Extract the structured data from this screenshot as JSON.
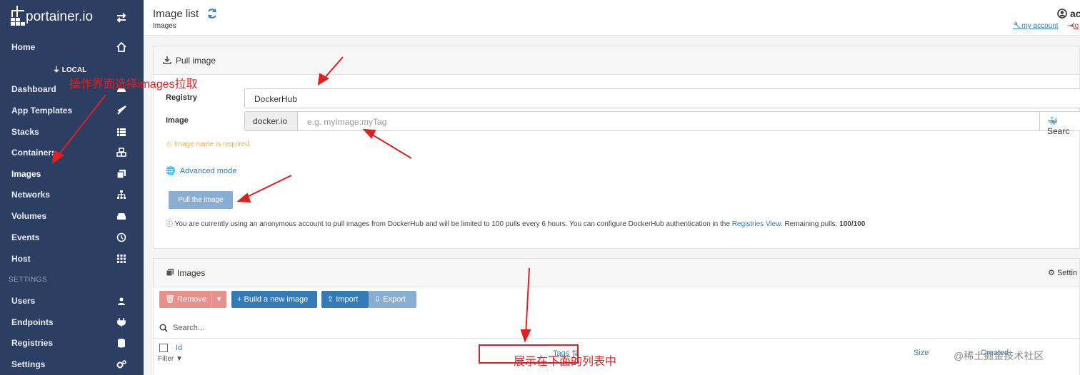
{
  "brand": {
    "name": "portainer.io"
  },
  "sidebar": {
    "home": "Home",
    "endpoint_label": "LOCAL",
    "items": [
      {
        "label": "Dashboard",
        "icon": "tachometer-icon"
      },
      {
        "label": "App Templates",
        "icon": "rocket-icon"
      },
      {
        "label": "Stacks",
        "icon": "th-list-icon"
      },
      {
        "label": "Containers",
        "icon": "cubes-icon"
      },
      {
        "label": "Images",
        "icon": "clone-icon"
      },
      {
        "label": "Networks",
        "icon": "sitemap-icon"
      },
      {
        "label": "Volumes",
        "icon": "hdd-icon"
      },
      {
        "label": "Events",
        "icon": "history-icon"
      },
      {
        "label": "Host",
        "icon": "th-icon"
      }
    ],
    "settings_heading": "SETTINGS",
    "settings_items": [
      {
        "label": "Users",
        "icon": "users-icon"
      },
      {
        "label": "Endpoints",
        "icon": "plug-icon"
      },
      {
        "label": "Registries",
        "icon": "database-icon"
      },
      {
        "label": "Settings",
        "icon": "cogs-icon"
      }
    ]
  },
  "header": {
    "title": "Image list",
    "breadcrumb": "Images",
    "user": "ac",
    "my_account": "my account",
    "logout": "lo"
  },
  "pull_panel": {
    "title": "Pull image",
    "registry_label": "Registry",
    "registry_value": "DockerHub",
    "image_label": "Image",
    "image_prefix": "docker.io",
    "image_placeholder": "e.g. myImage:myTag",
    "search_label": "Searc",
    "warning": "Image name is required.",
    "advanced_mode": "Advanced mode",
    "pull_button": "Pull the image",
    "info_text": "You are currently using an anonymous account to pull images from DockerHub and will be limited to 100 pulls every 6 hours. You can configure DockerHub authentication in the",
    "info_link": "Registries View",
    "info_tail": ". Remaining pulls:",
    "remaining": "100/100"
  },
  "images_panel": {
    "title": "Images",
    "settings": "Settin",
    "remove": "Remove",
    "build": "Build a new image",
    "import": "Import",
    "export": "Export",
    "search_placeholder": "Search...",
    "col_id": "Id",
    "filter": "Filter",
    "col_tags": "Tags",
    "col_size": "Size",
    "col_created": "Created"
  },
  "annotations": {
    "top": "操作界面选择images拉取",
    "bottom": "展示在下面的列表中"
  },
  "watermark": "@稀土掘金技术社区",
  "colors": {
    "sidebar": "#2d3e63",
    "danger": "#d9534f",
    "primary": "#337ab7",
    "annotation": "#e02020"
  }
}
